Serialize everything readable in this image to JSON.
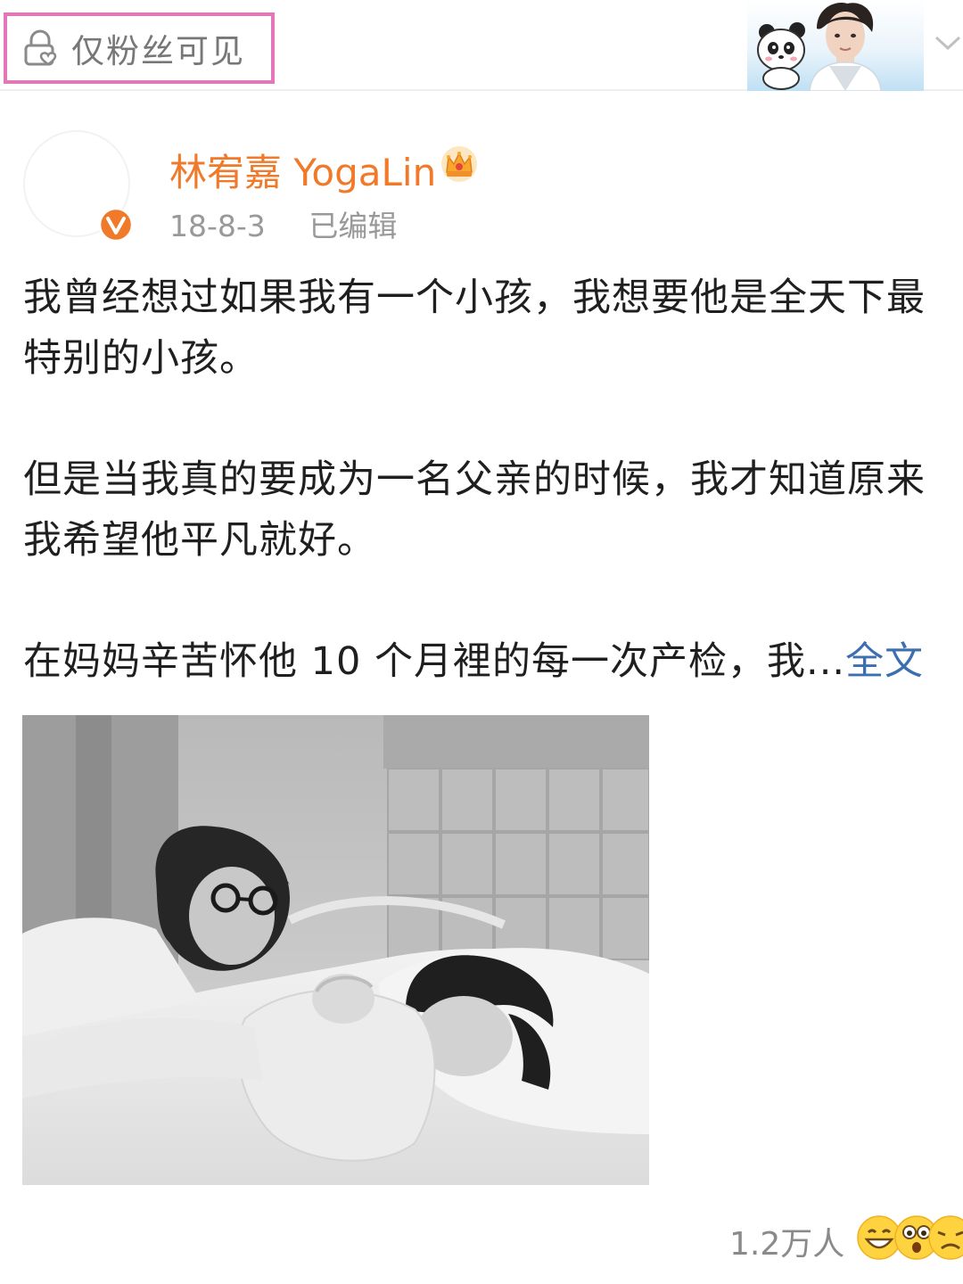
{
  "header": {
    "visibility_label": "仅粉丝可见"
  },
  "author": {
    "name": "林宥嘉 YogaLin",
    "date": "18-8-3",
    "edited_label": "已编辑"
  },
  "post": {
    "paragraphs": [
      "我曾经想过如果我有一个小孩，我想要他是全天下最特别的小孩。",
      "但是当我真的要成为一名父亲的时候，我才知道原来我希望他平凡就好。",
      "在妈妈辛苦怀他 10 个月裡的每一次产检，我..."
    ],
    "more_label": "全文"
  },
  "footer": {
    "reactions_count": "1.2万人"
  },
  "colors": {
    "author_name": "#f07a2a",
    "more_link": "#3c6fb0",
    "highlight_border": "#e377b9",
    "verified_badge": "#f07a2a"
  },
  "icons": [
    "lock-heart-icon",
    "chevron-down-icon",
    "verified-badge-icon",
    "crown-icon",
    "grin-emoji-icon",
    "surprised-emoji-icon",
    "sad-emoji-icon"
  ]
}
